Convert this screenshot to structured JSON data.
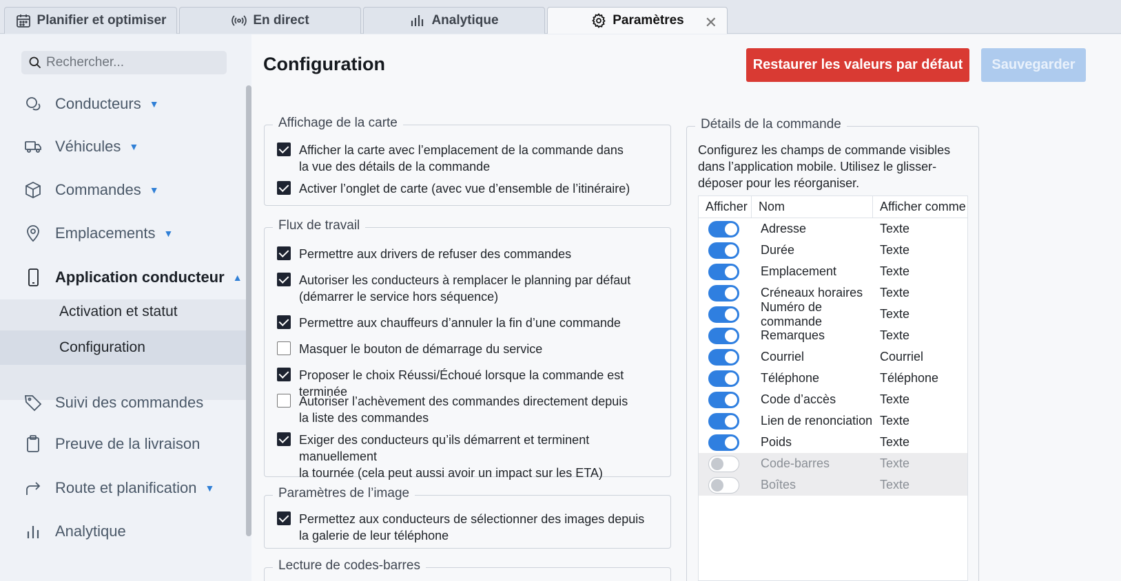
{
  "tabs": [
    {
      "label": "Planifier et optimiser",
      "icon": "calendar-icon"
    },
    {
      "label": "En direct",
      "icon": "broadcast-icon"
    },
    {
      "label": "Analytique",
      "icon": "bar-chart-icon"
    },
    {
      "label": "Paramètres",
      "icon": "gear-icon",
      "active": true
    }
  ],
  "tab_close": "✕",
  "search": {
    "placeholder": "Rechercher..."
  },
  "sidebar": {
    "items": [
      {
        "label": "Conducteurs",
        "icon": "drivers-icon"
      },
      {
        "label": "Véhicules",
        "icon": "truck-icon"
      },
      {
        "label": "Commandes",
        "icon": "box-icon"
      },
      {
        "label": "Emplacements",
        "icon": "location-pin-icon"
      },
      {
        "label": "Application conducteur",
        "icon": "mobile-phone-icon"
      },
      {
        "label": "Suivi des commandes",
        "icon": "tag-icon"
      },
      {
        "label": "Preuve de la livraison",
        "icon": "clipboard-icon"
      },
      {
        "label": "Route et planification",
        "icon": "route-arrow-icon"
      },
      {
        "label": "Analytique",
        "icon": "bar-chart-icon"
      }
    ],
    "sub_items": [
      "Activation et statut",
      "Configuration"
    ]
  },
  "page": {
    "title": "Configuration",
    "restore_label": "Restaurer les valeurs par défaut",
    "save_label": "Sauvegarder"
  },
  "map_display": {
    "legend": "Affichage de la carte",
    "options": [
      {
        "lines": [
          "Afficher la carte avec l’emplacement de la commande dans",
          "la vue des détails de la commande"
        ],
        "checked": true
      },
      {
        "lines": [
          "Activer l’onglet de carte (avec vue d’ensemble de l’itinéraire)"
        ],
        "checked": true
      }
    ]
  },
  "workflow": {
    "legend": "Flux de travail",
    "options": [
      {
        "lines": [
          "Permettre aux drivers de refuser des commandes"
        ],
        "checked": true
      },
      {
        "lines": [
          "Autoriser les conducteurs à remplacer le planning par défaut",
          "(démarrer le service hors séquence)"
        ],
        "checked": true
      },
      {
        "lines": [
          "Permettre aux chauffeurs d’annuler la fin d’une commande"
        ],
        "checked": true
      },
      {
        "lines": [
          "Masquer le bouton de démarrage du service"
        ],
        "checked": false
      },
      {
        "lines": [
          "Proposer le choix Réussi/Échoué lorsque la commande est terminée"
        ],
        "checked": true
      },
      {
        "lines": [
          "Autoriser l’achèvement des commandes directement depuis",
          "la liste des commandes"
        ],
        "checked": false
      },
      {
        "lines": [
          "Exiger des conducteurs qu’ils démarrent et terminent manuellement",
          "la tournée (cela peut aussi avoir un impact sur les ETA)"
        ],
        "checked": true
      }
    ]
  },
  "image_settings": {
    "legend": "Paramètres de l’image",
    "options": [
      {
        "lines": [
          "Permettez aux conducteurs de sélectionner des images depuis",
          "la galerie de leur téléphone"
        ],
        "checked": true
      }
    ]
  },
  "barcode": {
    "legend": "Lecture de codes-barres"
  },
  "order_details": {
    "legend": "Détails de la commande",
    "description": "Configurez les champs de commande visibles dans l’application mobile. Utilisez le glisser-déposer pour les réorganiser.",
    "headers": [
      "Afficher",
      "Nom",
      "Afficher comme"
    ],
    "rows": [
      {
        "name": "Adresse",
        "display": "Texte",
        "on": true
      },
      {
        "name": "Durée",
        "display": "Texte",
        "on": true
      },
      {
        "name": "Emplacement",
        "display": "Texte",
        "on": true
      },
      {
        "name": "Créneaux horaires",
        "display": "Texte",
        "on": true
      },
      {
        "name": "Numéro de commande",
        "display": "Texte",
        "on": true
      },
      {
        "name": "Remarques",
        "display": "Texte",
        "on": true
      },
      {
        "name": "Courriel",
        "display": "Courriel",
        "on": true
      },
      {
        "name": "Téléphone",
        "display": "Téléphone",
        "on": true
      },
      {
        "name": "Code d’accès",
        "display": "Texte",
        "on": true
      },
      {
        "name": "Lien de renonciation",
        "display": "Texte",
        "on": true
      },
      {
        "name": "Poids",
        "display": "Texte",
        "on": true
      },
      {
        "name": "Code-barres",
        "display": "Texte",
        "on": false
      },
      {
        "name": "Boîtes",
        "display": "Texte",
        "on": false
      }
    ]
  },
  "colors": {
    "accent": "#2f7fe0",
    "danger": "#d93a33",
    "save_disabled": "#aecbee"
  }
}
